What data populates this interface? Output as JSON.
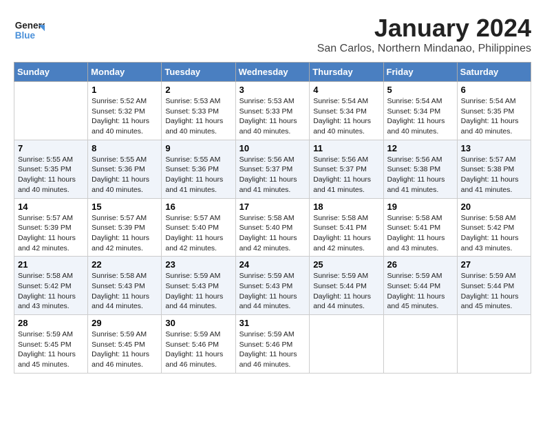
{
  "header": {
    "logo_general": "General",
    "logo_blue": "Blue",
    "month_title": "January 2024",
    "subtitle": "San Carlos, Northern Mindanao, Philippines"
  },
  "days_of_week": [
    "Sunday",
    "Monday",
    "Tuesday",
    "Wednesday",
    "Thursday",
    "Friday",
    "Saturday"
  ],
  "weeks": [
    [
      {
        "day": "",
        "content": ""
      },
      {
        "day": "1",
        "content": "Sunrise: 5:52 AM\nSunset: 5:32 PM\nDaylight: 11 hours\nand 40 minutes."
      },
      {
        "day": "2",
        "content": "Sunrise: 5:53 AM\nSunset: 5:33 PM\nDaylight: 11 hours\nand 40 minutes."
      },
      {
        "day": "3",
        "content": "Sunrise: 5:53 AM\nSunset: 5:33 PM\nDaylight: 11 hours\nand 40 minutes."
      },
      {
        "day": "4",
        "content": "Sunrise: 5:54 AM\nSunset: 5:34 PM\nDaylight: 11 hours\nand 40 minutes."
      },
      {
        "day": "5",
        "content": "Sunrise: 5:54 AM\nSunset: 5:34 PM\nDaylight: 11 hours\nand 40 minutes."
      },
      {
        "day": "6",
        "content": "Sunrise: 5:54 AM\nSunset: 5:35 PM\nDaylight: 11 hours\nand 40 minutes."
      }
    ],
    [
      {
        "day": "7",
        "content": "Sunrise: 5:55 AM\nSunset: 5:35 PM\nDaylight: 11 hours\nand 40 minutes."
      },
      {
        "day": "8",
        "content": "Sunrise: 5:55 AM\nSunset: 5:36 PM\nDaylight: 11 hours\nand 40 minutes."
      },
      {
        "day": "9",
        "content": "Sunrise: 5:55 AM\nSunset: 5:36 PM\nDaylight: 11 hours\nand 41 minutes."
      },
      {
        "day": "10",
        "content": "Sunrise: 5:56 AM\nSunset: 5:37 PM\nDaylight: 11 hours\nand 41 minutes."
      },
      {
        "day": "11",
        "content": "Sunrise: 5:56 AM\nSunset: 5:37 PM\nDaylight: 11 hours\nand 41 minutes."
      },
      {
        "day": "12",
        "content": "Sunrise: 5:56 AM\nSunset: 5:38 PM\nDaylight: 11 hours\nand 41 minutes."
      },
      {
        "day": "13",
        "content": "Sunrise: 5:57 AM\nSunset: 5:38 PM\nDaylight: 11 hours\nand 41 minutes."
      }
    ],
    [
      {
        "day": "14",
        "content": "Sunrise: 5:57 AM\nSunset: 5:39 PM\nDaylight: 11 hours\nand 42 minutes."
      },
      {
        "day": "15",
        "content": "Sunrise: 5:57 AM\nSunset: 5:39 PM\nDaylight: 11 hours\nand 42 minutes."
      },
      {
        "day": "16",
        "content": "Sunrise: 5:57 AM\nSunset: 5:40 PM\nDaylight: 11 hours\nand 42 minutes."
      },
      {
        "day": "17",
        "content": "Sunrise: 5:58 AM\nSunset: 5:40 PM\nDaylight: 11 hours\nand 42 minutes."
      },
      {
        "day": "18",
        "content": "Sunrise: 5:58 AM\nSunset: 5:41 PM\nDaylight: 11 hours\nand 42 minutes."
      },
      {
        "day": "19",
        "content": "Sunrise: 5:58 AM\nSunset: 5:41 PM\nDaylight: 11 hours\nand 43 minutes."
      },
      {
        "day": "20",
        "content": "Sunrise: 5:58 AM\nSunset: 5:42 PM\nDaylight: 11 hours\nand 43 minutes."
      }
    ],
    [
      {
        "day": "21",
        "content": "Sunrise: 5:58 AM\nSunset: 5:42 PM\nDaylight: 11 hours\nand 43 minutes."
      },
      {
        "day": "22",
        "content": "Sunrise: 5:58 AM\nSunset: 5:43 PM\nDaylight: 11 hours\nand 44 minutes."
      },
      {
        "day": "23",
        "content": "Sunrise: 5:59 AM\nSunset: 5:43 PM\nDaylight: 11 hours\nand 44 minutes."
      },
      {
        "day": "24",
        "content": "Sunrise: 5:59 AM\nSunset: 5:43 PM\nDaylight: 11 hours\nand 44 minutes."
      },
      {
        "day": "25",
        "content": "Sunrise: 5:59 AM\nSunset: 5:44 PM\nDaylight: 11 hours\nand 44 minutes."
      },
      {
        "day": "26",
        "content": "Sunrise: 5:59 AM\nSunset: 5:44 PM\nDaylight: 11 hours\nand 45 minutes."
      },
      {
        "day": "27",
        "content": "Sunrise: 5:59 AM\nSunset: 5:44 PM\nDaylight: 11 hours\nand 45 minutes."
      }
    ],
    [
      {
        "day": "28",
        "content": "Sunrise: 5:59 AM\nSunset: 5:45 PM\nDaylight: 11 hours\nand 45 minutes."
      },
      {
        "day": "29",
        "content": "Sunrise: 5:59 AM\nSunset: 5:45 PM\nDaylight: 11 hours\nand 46 minutes."
      },
      {
        "day": "30",
        "content": "Sunrise: 5:59 AM\nSunset: 5:46 PM\nDaylight: 11 hours\nand 46 minutes."
      },
      {
        "day": "31",
        "content": "Sunrise: 5:59 AM\nSunset: 5:46 PM\nDaylight: 11 hours\nand 46 minutes."
      },
      {
        "day": "",
        "content": ""
      },
      {
        "day": "",
        "content": ""
      },
      {
        "day": "",
        "content": ""
      }
    ]
  ]
}
